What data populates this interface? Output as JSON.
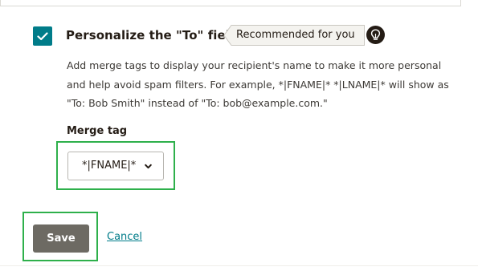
{
  "feature": {
    "checked": true,
    "title": "Personalize the \"To\" field",
    "badge": "Recommended for you",
    "badge_icon": "lightbulb-icon",
    "description": "Add merge tags to display your recipient's name to make it more personal and help avoid spam filters. For example, *|FNAME|* *|LNAME|* will show as \"To: Bob Smith\" instead of \"To: bob@example.com.\""
  },
  "merge_tag": {
    "label": "Merge tag",
    "selected": "*|FNAME|*"
  },
  "actions": {
    "save_label": "Save",
    "cancel_label": "Cancel"
  },
  "colors": {
    "accent": "#007c89",
    "save_button": "#6d6a63",
    "highlight": "#2eb04b"
  }
}
